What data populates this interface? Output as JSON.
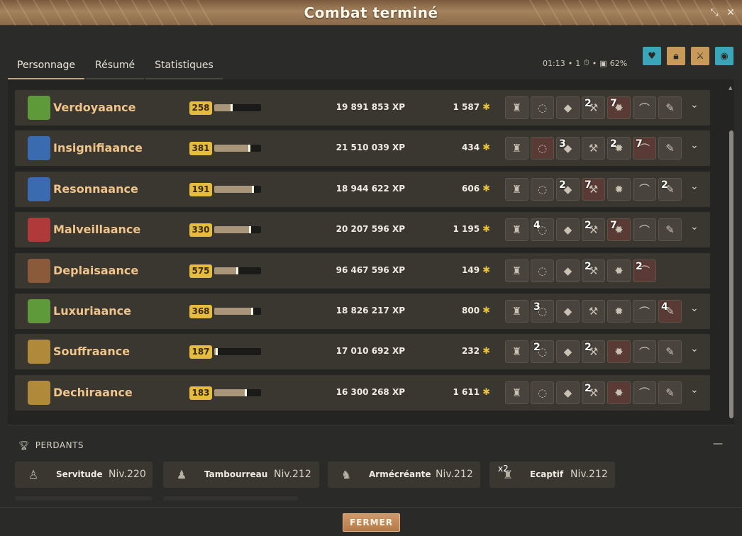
{
  "window": {
    "title": "Combat terminé"
  },
  "tabs": [
    {
      "label": "Personnage"
    },
    {
      "label": "Résumé"
    },
    {
      "label": "Statistiques"
    }
  ],
  "status": {
    "duration": "01:13",
    "turns": "1",
    "percent": "62%"
  },
  "header_icons": [
    {
      "name": "hearts-icon",
      "color": "#3aa6b8"
    },
    {
      "name": "lock-icon",
      "color": "#c89a5a"
    },
    {
      "name": "group-icon",
      "color": "#c89a5a"
    },
    {
      "name": "eye-icon",
      "color": "#3aa6b8"
    }
  ],
  "players": [
    {
      "name": "Verdoyaance",
      "level": "258",
      "level_progress": 0.38,
      "xp": "19 891 853 XP",
      "kamas": "1 587",
      "avatar_color": "#5f9a3a",
      "items": [
        {
          "q": ""
        },
        {
          "q": ""
        },
        {
          "q": ""
        },
        {
          "q": "2"
        },
        {
          "q": "7",
          "red": true
        },
        {
          "q": ""
        },
        {
          "q": ""
        }
      ],
      "expandable": true
    },
    {
      "name": "Insignifiaance",
      "level": "381",
      "level_progress": 0.75,
      "xp": "21 510 039 XP",
      "kamas": "434",
      "avatar_color": "#3a6ab0",
      "items": [
        {
          "q": ""
        },
        {
          "q": "",
          "red": true
        },
        {
          "q": "3"
        },
        {
          "q": ""
        },
        {
          "q": "2"
        },
        {
          "q": "7",
          "red": true
        },
        {
          "q": ""
        }
      ],
      "expandable": true
    },
    {
      "name": "Resonnaance",
      "level": "191",
      "level_progress": 0.84,
      "xp": "18 944 622 XP",
      "kamas": "606",
      "avatar_color": "#3a6ab0",
      "items": [
        {
          "q": ""
        },
        {
          "q": ""
        },
        {
          "q": "2"
        },
        {
          "q": "7",
          "red": true
        },
        {
          "q": ""
        },
        {
          "q": ""
        },
        {
          "q": "2"
        }
      ],
      "expandable": true
    },
    {
      "name": "Malveillaance",
      "level": "330",
      "level_progress": 0.78,
      "xp": "20 207 596 XP",
      "kamas": "1 195",
      "avatar_color": "#b03a3a",
      "items": [
        {
          "q": ""
        },
        {
          "q": "4"
        },
        {
          "q": ""
        },
        {
          "q": "2"
        },
        {
          "q": "7",
          "red": true
        },
        {
          "q": ""
        },
        {
          "q": ""
        }
      ],
      "expandable": true
    },
    {
      "name": "Deplaisaance",
      "level": "575",
      "level_progress": 0.5,
      "xp": "96 467 596 XP",
      "kamas": "149",
      "avatar_color": "#8a5a3a",
      "items": [
        {
          "q": ""
        },
        {
          "q": ""
        },
        {
          "q": ""
        },
        {
          "q": "2"
        },
        {
          "q": ""
        },
        {
          "q": "2",
          "red": true
        }
      ],
      "expandable": false
    },
    {
      "name": "Luxuriaance",
      "level": "368",
      "level_progress": 0.82,
      "xp": "18 826 217 XP",
      "kamas": "800",
      "avatar_color": "#5f9a3a",
      "items": [
        {
          "q": ""
        },
        {
          "q": "3"
        },
        {
          "q": ""
        },
        {
          "q": ""
        },
        {
          "q": ""
        },
        {
          "q": ""
        },
        {
          "q": "4",
          "red": true
        }
      ],
      "expandable": true
    },
    {
      "name": "Souffraance",
      "level": "187",
      "level_progress": 0.06,
      "xp": "17 010 692 XP",
      "kamas": "232",
      "avatar_color": "#b08a3a",
      "items": [
        {
          "q": ""
        },
        {
          "q": "2"
        },
        {
          "q": ""
        },
        {
          "q": "2"
        },
        {
          "q": "",
          "red": true
        },
        {
          "q": ""
        },
        {
          "q": ""
        }
      ],
      "expandable": true
    },
    {
      "name": "Dechiraance",
      "level": "183",
      "level_progress": 0.68,
      "xp": "16 300 268 XP",
      "kamas": "1 611",
      "avatar_color": "#b08a3a",
      "items": [
        {
          "q": ""
        },
        {
          "q": ""
        },
        {
          "q": ""
        },
        {
          "q": "2"
        },
        {
          "q": "",
          "red": true
        },
        {
          "q": ""
        },
        {
          "q": ""
        }
      ],
      "expandable": true
    }
  ],
  "losers": {
    "title": "PERDANTS",
    "items": [
      {
        "name": "Servitude",
        "level": "Niv.220",
        "qty": ""
      },
      {
        "name": "Tambourreau",
        "level": "Niv.212",
        "qty": ""
      },
      {
        "name": "Armécréante",
        "level": "Niv.212",
        "qty": ""
      },
      {
        "name": "Ecaptif",
        "level": "Niv.212",
        "qty": "x2"
      }
    ]
  },
  "footer": {
    "close_label": "FERMER"
  }
}
